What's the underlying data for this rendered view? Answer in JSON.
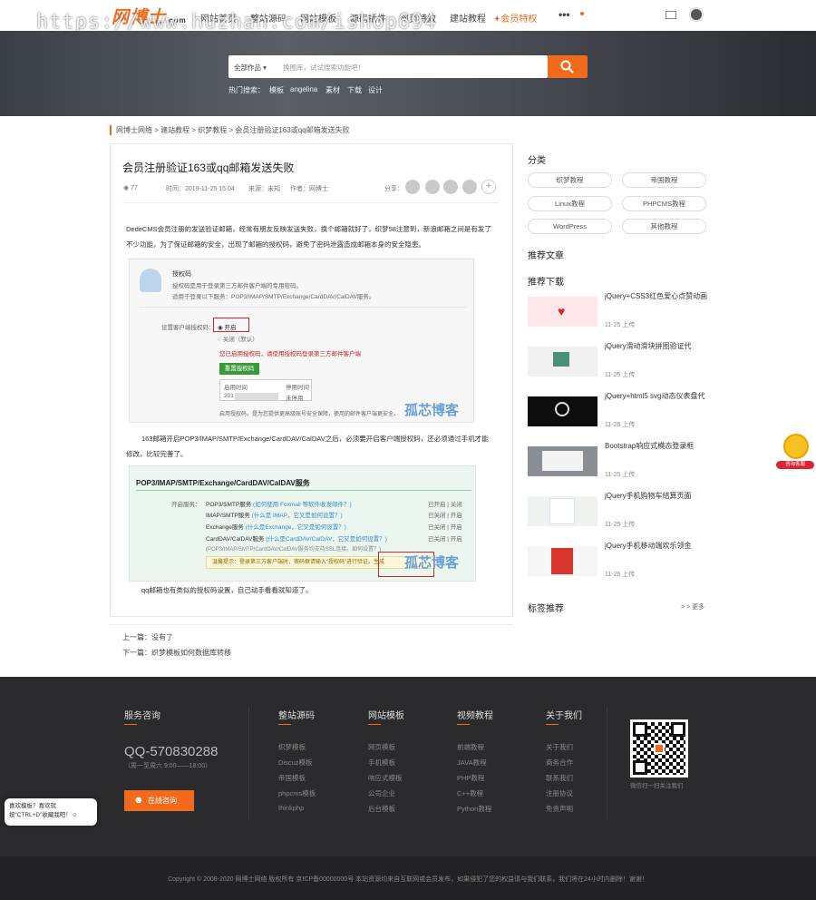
{
  "header": {
    "logo": "网博士",
    "logo_sub": ".com",
    "watermark": "https://www.huzhan.com/ishop694",
    "nav": [
      "网站首页",
      "整站源码",
      "网站模板",
      "源码插件",
      "网页特效",
      "建站教程",
      "会员特权",
      "•••"
    ]
  },
  "search": {
    "category": "全部作品",
    "placeholder": "换图库，试试搜索功能吧！",
    "hot_label": "热门搜索：",
    "hot": [
      "模板",
      "angelina",
      "素材",
      "下载",
      "设计"
    ]
  },
  "breadcrumb": "网博士网络 > 建站教程 > 织梦教程 > 会员注册验证163或qq邮箱发送失败",
  "article": {
    "title": "会员注册验证163或qq邮箱发送失败",
    "views": "77",
    "time": "时间：2019-11-25 15:04",
    "source": "来源：未知",
    "author": "作者：网博士",
    "share": "分享：",
    "p1": "DedeCMS会员注册的发送验证邮箱，经常有朋友反映发送失败，换个邮箱就好了，织梦58注意到，新浪邮箱之间是有发了不少功能，为了保证邮箱的安全，出现了邮箱的授权码，避免了密码泄露造成邮箱本身的安全隐患。",
    "shot1": {
      "title": "授权码",
      "desc1": "授权码是用于登录第三方邮件客户端的专用密码。",
      "desc2": "适用于登录以下服务：POP3/IMAP/SMTP/Exchange/CardDAV/CalDAV服务。",
      "label": "设置客户端授权码：",
      "on": "开启",
      "off": "关闭（默认）",
      "warn": "您已启用授权码，请使用授权码登录第三方邮件客户端",
      "btn": "重置授权码",
      "col1": "启用时间",
      "col2": "停用时间",
      "cell1": "201",
      "cell2": "未停用",
      "footnote": "启用授权码，是为您提供更高级账号安全保障，使用的邮件客户端更安全。",
      "wmark": "孤芯博客"
    },
    "p2": "163邮箱开启POP3/IMAP/SMTP/Exchange/CardDAV/CalDAV之后，必须要开启客户端授权码，还必须通过手机才能修改，比较完善了。",
    "shot2": {
      "title": "POP3/IMAP/SMTP/Exchange/CardDAV/CalDAV服务",
      "label": "开启服务：",
      "rows": [
        {
          "name": "POP3/SMTP服务",
          "hint": "(如何使用 Foxmail 等软件收发邮件？)",
          "status": "已开启 | 关闭"
        },
        {
          "name": "IMAP/SMTP服务",
          "hint": "(什么是 IMAP，它又是如何设置？)",
          "status": "已关闭 | 开启"
        },
        {
          "name": "Exchange服务",
          "hint": "(什么是Exchange，它又是如何设置？)",
          "status": "已关闭 | 开启"
        },
        {
          "name": "CardDAV/CalDAV服务",
          "hint": "(什么是CardDAV/CalDAV，它又是如何设置？)",
          "status": "已关闭 | 开启"
        }
      ],
      "note": "(POP3/IMAP/SMTP/CardDAV/CalDAV服务均支持SSL连接。如何设置？)",
      "warn": "温馨提示：登录第三方客户端时，密码框请输入“授权码”进行验证。生成",
      "wmark": "孤芯博客"
    },
    "p3": "qq邮箱也有类似的授权码设置，自己动手看看就知道了。",
    "prev": "上一篇：没有了",
    "next": "下一篇：织梦模板如何数据库转移"
  },
  "sidebar": {
    "cat_title": "分类",
    "tags": [
      "织梦教程",
      "帝国教程",
      "Linux教程",
      "PHPCMS教程",
      "WordPress",
      "其他教程"
    ],
    "rec_title": "推荐文章",
    "dl_title": "推荐下载",
    "downloads": [
      {
        "title": "jQuery+CSS3红色爱心点赞动画",
        "date": "11-25 上传"
      },
      {
        "title": "jQuery滑动滑块拼图验证代",
        "date": "11-25 上传"
      },
      {
        "title": "jQuery+html5 svg动态仪表盘代",
        "date": "11-25 上传"
      },
      {
        "title": "Bootstrap响应式模态登录框",
        "date": "11-25 上传"
      },
      {
        "title": "jQuery手机购物车结算页面",
        "date": "11-25 上传"
      },
      {
        "title": "jQuery手机移动端欢乐领金",
        "date": "11-25 上传"
      }
    ],
    "tags_title": "标签推荐",
    "more": "> > 更多"
  },
  "float": {
    "badge": "咨询客服"
  },
  "footer": {
    "consult": "服务咨询",
    "qq": "QQ-570830288",
    "hours": "（周一至周六 9:00——18:00）",
    "online": "在线咨询",
    "cols": [
      {
        "title": "整站源码",
        "links": [
          "织梦模板",
          "Discuz模板",
          "帝国模板",
          "phpcms模板",
          "thinkphp"
        ]
      },
      {
        "title": "网站模板",
        "links": [
          "网页模板",
          "手机模板",
          "响应式模板",
          "公司企业",
          "后台模板"
        ]
      },
      {
        "title": "视频教程",
        "links": [
          "前端教程",
          "JAVA教程",
          "PHP教程",
          "C++教程",
          "Python教程"
        ]
      },
      {
        "title": "关于我们",
        "links": [
          "关于我们",
          "商务合作",
          "联系我们",
          "注册协议",
          "免责声明"
        ]
      }
    ],
    "qr_caption": "微信扫一扫关注我们",
    "copyright": "Copyright © 2008-2020 网博士网络 版权所有 京ICP备00000000号 本站资源均来自互联网或会员发布，如果侵犯了您的权益请与我们联系，我们将在24小时内删除！谢谢！",
    "tip": "喜欢模板？喜欢就按“CTRL+D”收藏我吧！☺"
  }
}
